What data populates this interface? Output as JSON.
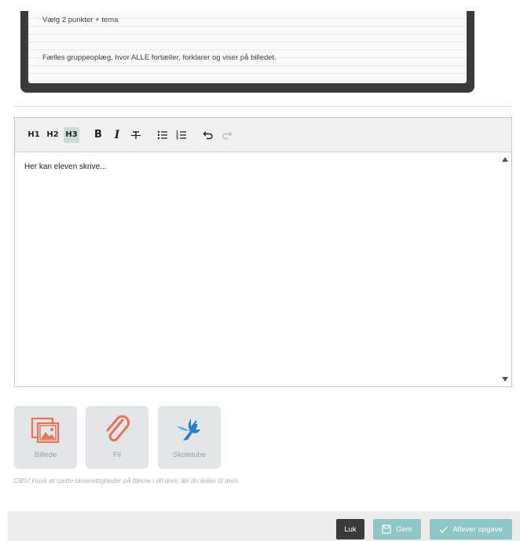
{
  "task": {
    "lines": [
      "Vælg 2 punkter + tema",
      "Fælles gruppeoplæg, hvor ALLE fortæller, forklarer og viser på billedet."
    ]
  },
  "toolbar": {
    "h1": "H1",
    "h2": "H2",
    "h3": "H3",
    "bold": "B",
    "italic": "I",
    "strike": "∓",
    "bullet_list": "☰",
    "ordered_list": "☷",
    "undo": "↶",
    "redo": "↷",
    "active": "H3"
  },
  "editor": {
    "placeholder": "Her kan eleven skrive..."
  },
  "attachments": [
    {
      "label": "Billede",
      "icon": "image-gallery-icon"
    },
    {
      "label": "Fil",
      "icon": "paperclip-icon"
    },
    {
      "label": "Skoletube",
      "icon": "bird-icon"
    }
  ],
  "obs_note": "OBS! Husk at sætte læserettigheder på filerne i dit drev, før du linker til dem.",
  "footer": {
    "close_label": "Luk",
    "save_label": "Gem",
    "submit_label": "Aflever opgave"
  },
  "colors": {
    "accent": "#8fc6c6",
    "dark": "#3a3a3a",
    "active_format": "#c9dcd8",
    "tile_bg": "#e2e6e6",
    "attachment_icon": "#e8735a",
    "bird_icon": "#2c7fc7"
  }
}
